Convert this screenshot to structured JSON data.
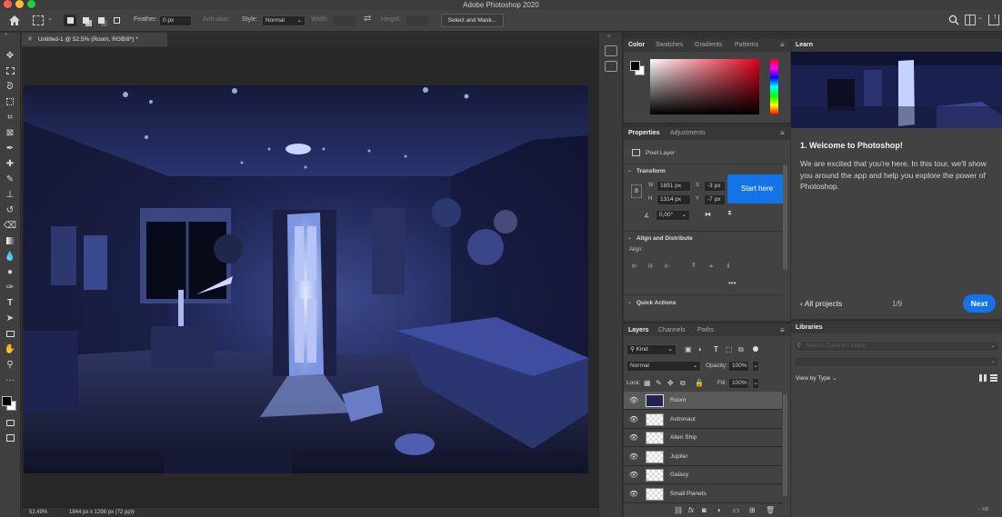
{
  "window": {
    "title": "Adobe Photoshop 2020"
  },
  "options_bar": {
    "feather_label": "Feather:",
    "feather_value": "0 px",
    "antialias_label": "Anti-alias",
    "style_label": "Style:",
    "style_value": "Normal",
    "width_label": "Width:",
    "height_label": "Height:",
    "select_mask_label": "Select and Mask..."
  },
  "document": {
    "tab_title": "Untitled-1 @ 52,5% (Room, RGB/8*) *",
    "zoom": "52,49%",
    "info": "1844 px x 1298 px (72 ppi)"
  },
  "color_panel": {
    "tabs": [
      "Color",
      "Swatches",
      "Gradients",
      "Patterns"
    ]
  },
  "properties_panel": {
    "tabs": [
      "Properties",
      "Adjustments"
    ],
    "layer_type": "Pixel Layer",
    "transform_label": "Transform",
    "w_label": "W",
    "w_value": "1851 px",
    "h_label": "H",
    "h_value": "1314 px",
    "x_label": "X",
    "x_value": "-3 px",
    "y_label": "Y",
    "y_value": "-7 px",
    "angle_value": "0,00°",
    "align_section": "Align and Distribute",
    "align_label": "Align:",
    "quick_actions": "Quick Actions",
    "tooltip": "Start here"
  },
  "layers_panel": {
    "tabs": [
      "Layers",
      "Channels",
      "Paths"
    ],
    "kind_label": "Kind",
    "blend_mode": "Normal",
    "opacity_label": "Opacity:",
    "opacity_value": "100%",
    "lock_label": "Lock:",
    "fill_label": "Fill:",
    "fill_value": "100%",
    "layers": [
      {
        "name": "Room",
        "selected": true
      },
      {
        "name": "Astronaut",
        "selected": false
      },
      {
        "name": "Alien Ship",
        "selected": false
      },
      {
        "name": "Jupiter",
        "selected": false
      },
      {
        "name": "Galaxy",
        "selected": false
      },
      {
        "name": "Small Planets",
        "selected": false
      }
    ],
    "footer_fx": "fx"
  },
  "learn_panel": {
    "tab": "Learn",
    "heading": "1.  Welcome to Photoshop!",
    "body": "We are excited that you're here. In this tour, we'll show you around the app and help you explore the power of Photoshop.",
    "all_projects": "All projects",
    "page": "1/9",
    "next": "Next"
  },
  "libraries_panel": {
    "tab": "Libraries",
    "search_placeholder": "Search Current Library",
    "view_by": "View by Type",
    "size_label": "-- KB"
  },
  "colors": {
    "accent": "#1473e6",
    "panel": "#535353",
    "canvas_bg": "#282828"
  }
}
